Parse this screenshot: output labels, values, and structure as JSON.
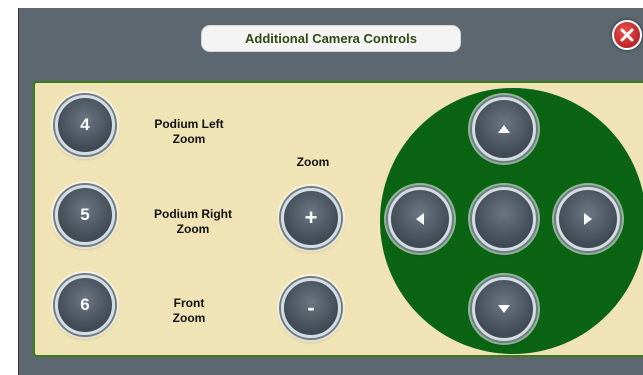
{
  "dialog": {
    "title": "Additional Camera Controls",
    "close": {
      "icon": "close-icon",
      "color": "#d2232a"
    }
  },
  "presets": [
    {
      "number": "4",
      "label": "Podium Left\nZoom"
    },
    {
      "number": "5",
      "label": "Podium Right\nZoom"
    },
    {
      "number": "6",
      "label": "Front\nZoom"
    }
  ],
  "zoom": {
    "label": "Zoom",
    "in_symbol": "+",
    "out_symbol": "-"
  },
  "dpad": {
    "up_icon": "arrow-up-icon",
    "down_icon": "arrow-down-icon",
    "left_icon": "arrow-left-icon",
    "right_icon": "arrow-right-icon",
    "center_icon": "none"
  },
  "colors": {
    "panel": "#f0e4b6",
    "panel_border": "#3a7a1c",
    "dpad_background": "#0b6414",
    "window_background": "#5c6770",
    "title_text": "#2e4a12"
  }
}
